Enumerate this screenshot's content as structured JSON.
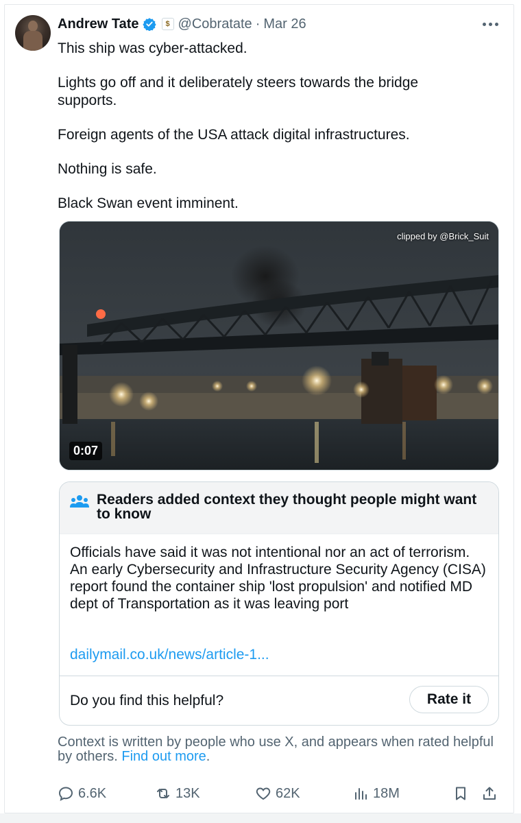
{
  "post": {
    "author_name": "Andrew Tate",
    "handle": "@Cobratate",
    "date": "Mar 26",
    "dot": "·",
    "text": [
      "This ship was cyber-attacked.",
      "Lights go off and it deliberately steers towards the bridge supports.",
      "Foreign agents of the USA attack digital infrastructures.",
      "Nothing is safe.",
      "Black Swan event imminent."
    ]
  },
  "media": {
    "credit": "clipped by @Brick_Suit",
    "duration": "0:07"
  },
  "community_note": {
    "title": "Readers added context they thought people might want to know",
    "body": "Officials have said it was not intentional nor an act of terrorism. An early Cybersecurity and Infrastructure Security Agency (CISA) report found the container ship 'lost propulsion' and notified MD dept of Transportation as it was leaving port",
    "link": "dailymail.co.uk/news/article-1...",
    "helpful_prompt": "Do you find this helpful?",
    "rate_button": "Rate it"
  },
  "context_footer": {
    "text": "Context is written by people who use X, and appears when rated helpful by others.",
    "link": "Find out more",
    "period": "."
  },
  "actions": {
    "replies": "6.6K",
    "reposts": "13K",
    "likes": "62K",
    "views": "18M"
  },
  "colors": {
    "accent": "#1d9bf0",
    "secondary_text": "#536471",
    "border": "#cfd9de"
  }
}
